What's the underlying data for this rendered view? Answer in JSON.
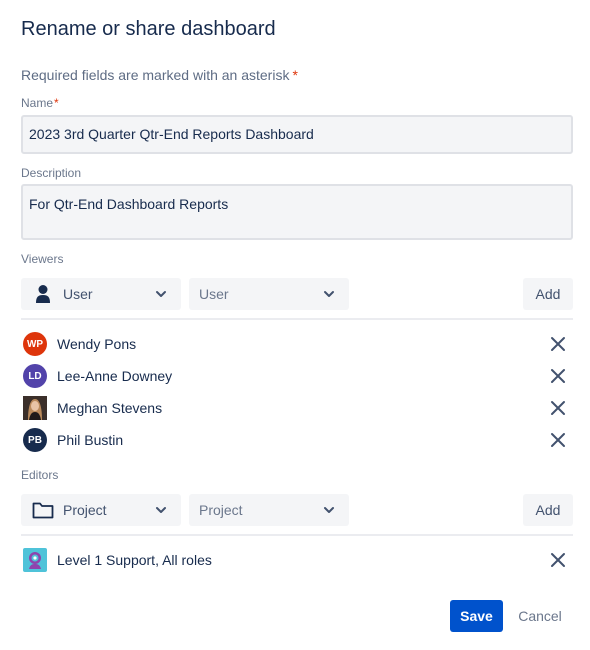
{
  "dialog": {
    "title": "Rename or share dashboard",
    "required_note": "Required fields are marked with an asterisk",
    "asterisk": "*"
  },
  "name": {
    "label": "Name",
    "value": "2023 3rd Quarter Qtr-End Reports Dashboard"
  },
  "description": {
    "label": "Description",
    "value": "For Qtr-End Dashboard Reports"
  },
  "viewers": {
    "label": "Viewers",
    "type_select": {
      "value": "User",
      "icon": "user-icon"
    },
    "target_select": {
      "value": "User"
    },
    "add_label": "Add",
    "items": [
      {
        "name": "Wendy Pons",
        "initials": "WP",
        "avatar_color": "#de350b"
      },
      {
        "name": "Lee-Anne Downey",
        "initials": "LD",
        "avatar_color": "#5243aa"
      },
      {
        "name": "Meghan Stevens",
        "initials": "",
        "avatar_color": "#4a3b33"
      },
      {
        "name": "Phil Bustin",
        "initials": "PB",
        "avatar_color": "#172b4d"
      }
    ]
  },
  "editors": {
    "label": "Editors",
    "type_select": {
      "value": "Project",
      "icon": "folder-icon"
    },
    "target_select": {
      "value": "Project"
    },
    "add_label": "Add",
    "items": [
      {
        "name": "Level 1 Support, All roles",
        "icon": "project-avatar-icon"
      }
    ]
  },
  "footer": {
    "save_label": "Save",
    "cancel_label": "Cancel"
  },
  "colors": {
    "primary": "#0052cc",
    "required": "#de350b",
    "field_bg": "#f4f5f7"
  }
}
